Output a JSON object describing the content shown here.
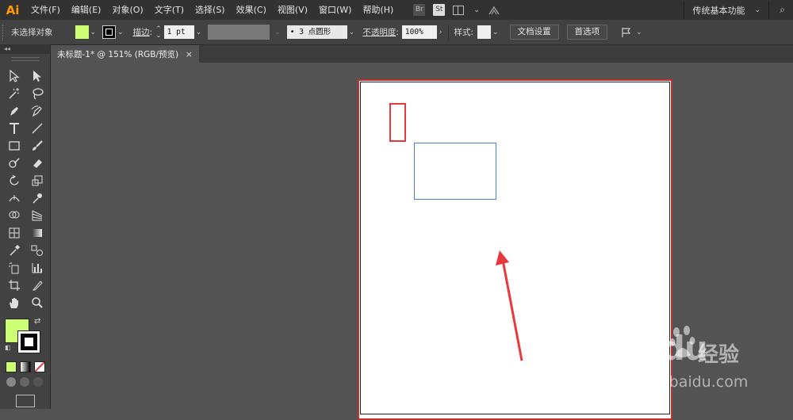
{
  "app": {
    "logo": "Ai"
  },
  "menu": [
    "文件(F)",
    "编辑(E)",
    "对象(O)",
    "文字(T)",
    "选择(S)",
    "效果(C)",
    "视图(V)",
    "窗口(W)",
    "帮助(H)"
  ],
  "menu_icons": {
    "br": "Br",
    "st": "St"
  },
  "workspace": {
    "label": "传统基本功能"
  },
  "controlbar": {
    "selection_label": "未选择对象",
    "fill_color": "#ccff73",
    "stroke_label": "描边",
    "stroke_colon": ":",
    "stroke_value": "1 pt",
    "brush_value": "• 3 点圆形",
    "opacity_label": "不透明度",
    "opacity_value": "100%",
    "style_label": "样式",
    "doc_setup_button": "文档设置",
    "prefs_button": "首选项"
  },
  "document_tab": {
    "title": "未标题-1* @ 151% (RGB/预览)",
    "close": "×"
  },
  "tools": {
    "fill_color": "#ccff73",
    "stroke_color": "#000000"
  },
  "canvas": {
    "artboard_border_color": "#c0322f",
    "annotation_rect_color": "#e8383d",
    "selection_rect_color": "#4a7fe8",
    "arrow_color": "#e8383d"
  },
  "watermark": {
    "brand": "Baidu",
    "cn": "经验",
    "url": "jingyan.baidu.com"
  }
}
